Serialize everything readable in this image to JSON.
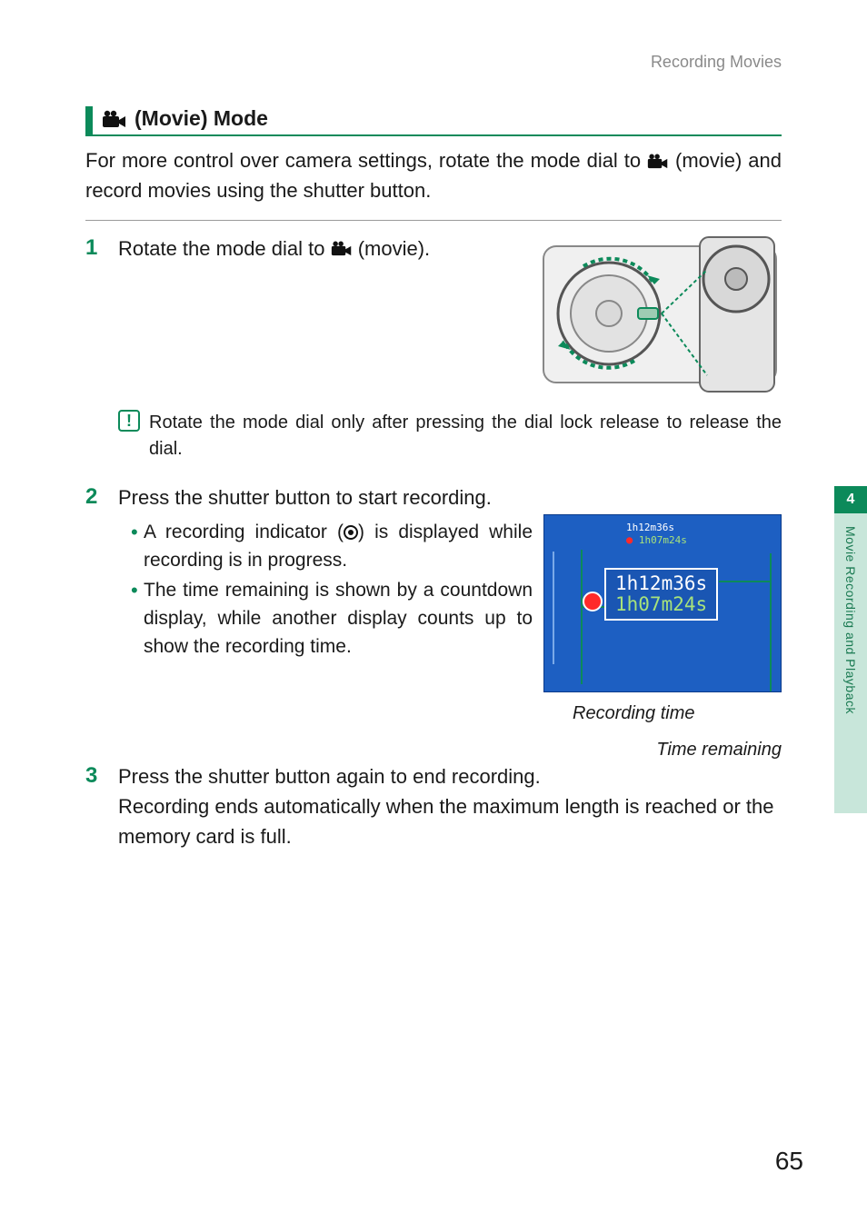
{
  "header": {
    "breadcrumb": "Recording Movies"
  },
  "section_title": "(Movie) Mode",
  "intro": {
    "part1": "For more control over camera settings, rotate the mode dial to ",
    "part2": " (movie) and record movies using the shutter button."
  },
  "steps": {
    "s1": {
      "num": "1",
      "text_a": "Rotate the mode dial to ",
      "text_b": " (movie)."
    },
    "note": "Rotate the mode dial only after pressing the dial lock release to release the dial.",
    "s2": {
      "num": "2",
      "head": "Press the shutter button to start recording.",
      "b1a": "A recording indicator (",
      "b1b": ") is displayed while recording is in progress.",
      "b2": "The time remaining is shown by a countdown display, while another display counts up to show the recording time."
    },
    "s3": {
      "num": "3",
      "line1": "Press the shutter button again to end recording.",
      "line2": "Recording ends automatically when the maximum length is reached or the memory card is full."
    }
  },
  "screen": {
    "time_recorded": "1h12m36s",
    "time_remaining": "1h07m24s",
    "label_recording": "Recording time",
    "label_remaining": "Time remaining"
  },
  "sidebar": {
    "chapter_num": "4",
    "chapter_title": "Movie Recording and Playback"
  },
  "page_number": "65",
  "icons": {
    "movie": "movie-icon",
    "caution": "caution-icon",
    "record": "record-indicator-icon"
  }
}
